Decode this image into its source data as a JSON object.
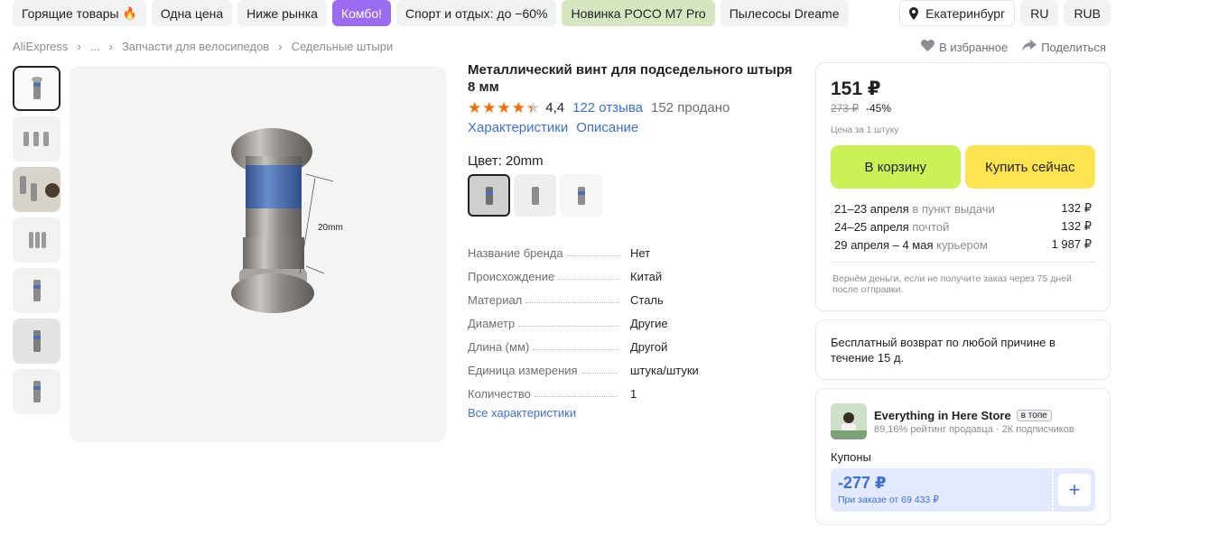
{
  "top_chips": [
    {
      "label": "Горящие товары",
      "style": "default"
    },
    {
      "label": "Одна цена",
      "style": "default"
    },
    {
      "label": "Ниже рынка",
      "style": "default"
    },
    {
      "label": "Комбо!",
      "style": "purple"
    },
    {
      "label": "Спорт и отдых: до −60%",
      "style": "default"
    },
    {
      "label": "Новинка POCO M7 Pro",
      "style": "green"
    },
    {
      "label": "Пылесосы Dreame",
      "style": "default"
    }
  ],
  "location": "Екатеринбург",
  "language": "RU",
  "currency": "RUB",
  "breadcrumb": [
    "AliExpress",
    "...",
    "Запчасти для велосипедов",
    "Седельные штыри"
  ],
  "actions": {
    "favorite": "В избранное",
    "share": "Поделиться"
  },
  "product": {
    "title": "Металлический винт для подседельного штыря 8 мм",
    "rating": "4,4",
    "reviews": "122 отзыва",
    "sold": "152 продано",
    "tab_specs": "Характеристики",
    "tab_description": "Описание",
    "color_label": "Цвет: 20mm",
    "image_annotation": "20mm",
    "specs": [
      {
        "k": "Название бренда",
        "v": "Нет"
      },
      {
        "k": "Происхождение",
        "v": "Китай"
      },
      {
        "k": "Материал",
        "v": "Сталь"
      },
      {
        "k": "Диаметр",
        "v": "Другие"
      },
      {
        "k": "Длина (мм)",
        "v": "Другой"
      },
      {
        "k": "Единица измерения",
        "v": "штука/штуки"
      },
      {
        "k": "Количество",
        "v": "1"
      }
    ],
    "all_specs": "Все характеристики"
  },
  "buybox": {
    "price": "151 ₽",
    "old_price": "273 ₽",
    "discount": "-45%",
    "unit": "Цена за 1 штуку",
    "cart_button": "В корзину",
    "buy_button": "Купить сейчас",
    "delivery": [
      {
        "date": "21–23 апреля",
        "method": "в пункт выдачи",
        "price": "132 ₽"
      },
      {
        "date": "24–25 апреля",
        "method": "почтой",
        "price": "132 ₽"
      },
      {
        "date": "29 апреля – 4 мая",
        "method": "курьером",
        "price": "1 987 ₽"
      }
    ],
    "refund_note": "Вернём деньги, если не получите заказ через 75 дней после отправки."
  },
  "return_policy": "Бесплатный возврат по любой причине в течение 15 д.",
  "store": {
    "name": "Everything in Here Store",
    "badge": "в топе",
    "rating": "89,16% рейтинг продавца",
    "followers": "2К подписчиков",
    "coupons_label": "Купоны",
    "coupon_value": "-277 ₽",
    "coupon_condition": "При заказе от 69 433 ₽"
  },
  "colors": {
    "purple_chip": "#9b6cf2",
    "green_chip": "#d6e6c0",
    "cart": "#c8f255",
    "buy": "#fde450",
    "link": "#3e6fd8",
    "star": "#ff6a00"
  }
}
